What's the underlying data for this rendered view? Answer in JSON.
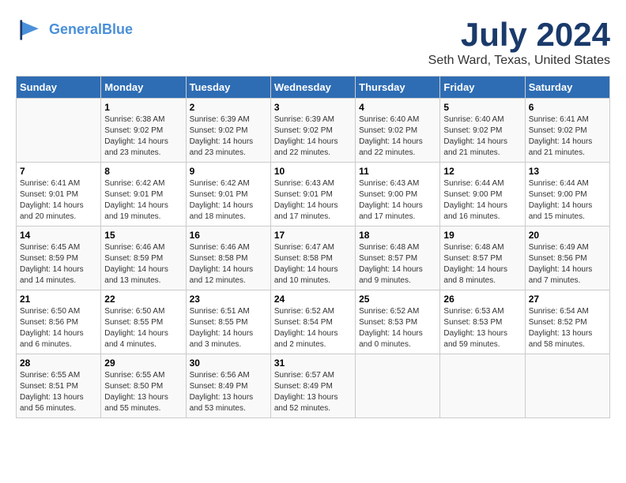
{
  "logo": {
    "line1": "General",
    "line2": "Blue"
  },
  "title": "July 2024",
  "subtitle": "Seth Ward, Texas, United States",
  "days_header": [
    "Sunday",
    "Monday",
    "Tuesday",
    "Wednesday",
    "Thursday",
    "Friday",
    "Saturday"
  ],
  "weeks": [
    [
      {
        "num": "",
        "info": ""
      },
      {
        "num": "1",
        "info": "Sunrise: 6:38 AM\nSunset: 9:02 PM\nDaylight: 14 hours\nand 23 minutes."
      },
      {
        "num": "2",
        "info": "Sunrise: 6:39 AM\nSunset: 9:02 PM\nDaylight: 14 hours\nand 23 minutes."
      },
      {
        "num": "3",
        "info": "Sunrise: 6:39 AM\nSunset: 9:02 PM\nDaylight: 14 hours\nand 22 minutes."
      },
      {
        "num": "4",
        "info": "Sunrise: 6:40 AM\nSunset: 9:02 PM\nDaylight: 14 hours\nand 22 minutes."
      },
      {
        "num": "5",
        "info": "Sunrise: 6:40 AM\nSunset: 9:02 PM\nDaylight: 14 hours\nand 21 minutes."
      },
      {
        "num": "6",
        "info": "Sunrise: 6:41 AM\nSunset: 9:02 PM\nDaylight: 14 hours\nand 21 minutes."
      }
    ],
    [
      {
        "num": "7",
        "info": "Sunrise: 6:41 AM\nSunset: 9:01 PM\nDaylight: 14 hours\nand 20 minutes."
      },
      {
        "num": "8",
        "info": "Sunrise: 6:42 AM\nSunset: 9:01 PM\nDaylight: 14 hours\nand 19 minutes."
      },
      {
        "num": "9",
        "info": "Sunrise: 6:42 AM\nSunset: 9:01 PM\nDaylight: 14 hours\nand 18 minutes."
      },
      {
        "num": "10",
        "info": "Sunrise: 6:43 AM\nSunset: 9:01 PM\nDaylight: 14 hours\nand 17 minutes."
      },
      {
        "num": "11",
        "info": "Sunrise: 6:43 AM\nSunset: 9:00 PM\nDaylight: 14 hours\nand 17 minutes."
      },
      {
        "num": "12",
        "info": "Sunrise: 6:44 AM\nSunset: 9:00 PM\nDaylight: 14 hours\nand 16 minutes."
      },
      {
        "num": "13",
        "info": "Sunrise: 6:44 AM\nSunset: 9:00 PM\nDaylight: 14 hours\nand 15 minutes."
      }
    ],
    [
      {
        "num": "14",
        "info": "Sunrise: 6:45 AM\nSunset: 8:59 PM\nDaylight: 14 hours\nand 14 minutes."
      },
      {
        "num": "15",
        "info": "Sunrise: 6:46 AM\nSunset: 8:59 PM\nDaylight: 14 hours\nand 13 minutes."
      },
      {
        "num": "16",
        "info": "Sunrise: 6:46 AM\nSunset: 8:58 PM\nDaylight: 14 hours\nand 12 minutes."
      },
      {
        "num": "17",
        "info": "Sunrise: 6:47 AM\nSunset: 8:58 PM\nDaylight: 14 hours\nand 10 minutes."
      },
      {
        "num": "18",
        "info": "Sunrise: 6:48 AM\nSunset: 8:57 PM\nDaylight: 14 hours\nand 9 minutes."
      },
      {
        "num": "19",
        "info": "Sunrise: 6:48 AM\nSunset: 8:57 PM\nDaylight: 14 hours\nand 8 minutes."
      },
      {
        "num": "20",
        "info": "Sunrise: 6:49 AM\nSunset: 8:56 PM\nDaylight: 14 hours\nand 7 minutes."
      }
    ],
    [
      {
        "num": "21",
        "info": "Sunrise: 6:50 AM\nSunset: 8:56 PM\nDaylight: 14 hours\nand 6 minutes."
      },
      {
        "num": "22",
        "info": "Sunrise: 6:50 AM\nSunset: 8:55 PM\nDaylight: 14 hours\nand 4 minutes."
      },
      {
        "num": "23",
        "info": "Sunrise: 6:51 AM\nSunset: 8:55 PM\nDaylight: 14 hours\nand 3 minutes."
      },
      {
        "num": "24",
        "info": "Sunrise: 6:52 AM\nSunset: 8:54 PM\nDaylight: 14 hours\nand 2 minutes."
      },
      {
        "num": "25",
        "info": "Sunrise: 6:52 AM\nSunset: 8:53 PM\nDaylight: 14 hours\nand 0 minutes."
      },
      {
        "num": "26",
        "info": "Sunrise: 6:53 AM\nSunset: 8:53 PM\nDaylight: 13 hours\nand 59 minutes."
      },
      {
        "num": "27",
        "info": "Sunrise: 6:54 AM\nSunset: 8:52 PM\nDaylight: 13 hours\nand 58 minutes."
      }
    ],
    [
      {
        "num": "28",
        "info": "Sunrise: 6:55 AM\nSunset: 8:51 PM\nDaylight: 13 hours\nand 56 minutes."
      },
      {
        "num": "29",
        "info": "Sunrise: 6:55 AM\nSunset: 8:50 PM\nDaylight: 13 hours\nand 55 minutes."
      },
      {
        "num": "30",
        "info": "Sunrise: 6:56 AM\nSunset: 8:49 PM\nDaylight: 13 hours\nand 53 minutes."
      },
      {
        "num": "31",
        "info": "Sunrise: 6:57 AM\nSunset: 8:49 PM\nDaylight: 13 hours\nand 52 minutes."
      },
      {
        "num": "",
        "info": ""
      },
      {
        "num": "",
        "info": ""
      },
      {
        "num": "",
        "info": ""
      }
    ]
  ]
}
